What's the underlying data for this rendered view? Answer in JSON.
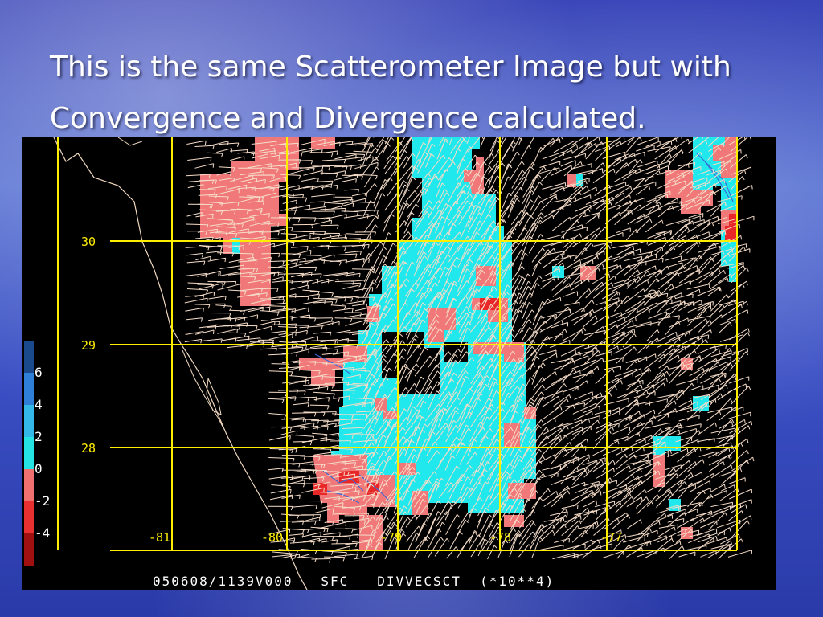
{
  "slide": {
    "title_line1": "This is the same Scatterometer Image but with",
    "title_line2": "Convergence and Divergence calculated."
  },
  "map": {
    "lat_labels": [
      "30",
      "29",
      "28"
    ],
    "lon_labels": [
      "-81",
      "-80",
      "-79",
      "-78",
      "-77"
    ],
    "footer": "050608/1139V000   SFC   DIVVECSCT  (*10**4)",
    "legend_labels": [
      "6",
      "4",
      "2",
      "0",
      "-2",
      "-4"
    ],
    "legend_colors": [
      "#1a4a8c",
      "#2f7fd8",
      "#33b8e8",
      "#26e3e3",
      "#f07070",
      "#e83030",
      "#a01010"
    ],
    "colors": {
      "grid": "#ffee00",
      "coast": "#f0d8c0",
      "cyan": "#20e8ec",
      "salmon": "#f07878",
      "red": "#e82828",
      "background": "#000000"
    }
  }
}
